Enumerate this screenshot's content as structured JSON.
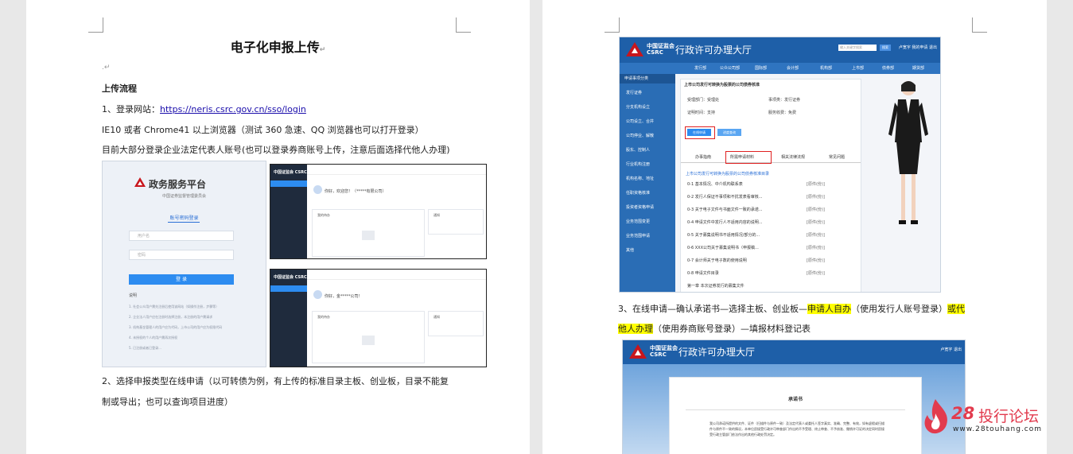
{
  "left_page": {
    "title": "电子化申报上传",
    "para_mark": "↵",
    "empty_mark": ".↵",
    "section_heading": "上传流程",
    "step1_prefix": "1、登录网站：",
    "step1_url": "https://neris.csrc.gov.cn/sso/login",
    "browser_note": "IE10 或者 Chrome41 以上浏览器（测试 360 急速、QQ 浏览器也可以打开登录）",
    "account_note": "目前大部分登录企业法定代表人账号(也可以登录券商账号上传，注意后面选择代他人办理)",
    "step2_line1": "2、选择申报类型在线申请（以可转债为例，有上传的标准目录主板、创业板，目录不能复",
    "step2_line2": "制或导出；也可以查询项目进度）",
    "login_shot": {
      "platform_name": "政务服务平台",
      "subtitle": "中国证券监督管理委员会",
      "tab_label": "账号密码登录",
      "username_placeholder": "用户名",
      "password_placeholder": "密码",
      "login_button": "登 录",
      "notes_title": "说明",
      "notes": [
        "1. 社会公众用户需先注册后使用该网站（如操作注册，步骤等）",
        "2. 企业法人用户应在注册时选择注册，本注册的用户需请求",
        "3. 机构基金管理人的用户应为代码，上市公司的用户应为权限代码",
        "4. 未授权的个人的用户需再次授权",
        "5. 已注册或者已登录..."
      ]
    },
    "dash_shot_1": {
      "brand": "中国证监会 CSRC",
      "welcome": "你好，欢迎您！（*****有限公司）",
      "card1_title": "我的待办",
      "card2_title": "通知"
    },
    "dash_shot_2": {
      "brand": "中国证监会 CSRC",
      "welcome": "你好，金*****公司！",
      "card1_title": "我的待办",
      "card2_title": "通知"
    }
  },
  "right_page": {
    "portal": {
      "org": "中国证监会",
      "org_en": "CSRC",
      "name": "行政许可办理大厅",
      "search_placeholder": "输入关键字搜索",
      "search_button": "搜索",
      "user_links": "卢宽宇  我的申请  退出",
      "nav": [
        "发行部",
        "公众公司部",
        "国际部",
        "会计部",
        "机构部",
        "上市部",
        "债券部",
        "期货部"
      ],
      "side_head": "申请事项分类",
      "side_items": [
        "发行证券",
        "分支机构设立",
        "公司设立、合并",
        "公司停业、解散",
        "股东、控制人",
        "行业机构注册",
        "机构名称、地址",
        "任职资格核准",
        "投资者资格申请",
        "业务范围变更",
        "业务范围申请",
        "其他"
      ],
      "main_title": "上市公司发行可转换为股票的公司债券核准",
      "dept_label": "受理部门：受理处",
      "matter_label": "事项类：发行证券",
      "cert_label": "证明时间：",
      "cert_value": "支持",
      "fee_label": "服务收费：",
      "fee_value": "免费",
      "btn_apply": "在线申请",
      "btn_query": "进度查询",
      "tabs": [
        "办事指南",
        "所需申请材料",
        "相关法律法规",
        "常见问题"
      ],
      "list_title": "上市公司发行可转换为股票的公司债券核准目录",
      "rows": [
        {
          "text": "0-1 基本情况、中介机构联系表",
          "status": "[原件(份)]"
        },
        {
          "text": "0-2 发行人保证不事项和不扰发表看审核...",
          "status": "[原件(份)]"
        },
        {
          "text": "0-3 关于电子文件与书面文件一致的承诺...",
          "status": "[原件(份)]"
        },
        {
          "text": "0-4 申请文件中发行人不适用内容的说明...",
          "status": "[原件(份)]"
        },
        {
          "text": "0-5 关于募集说明书不适用情况/部分的...",
          "status": "[原件(份)]"
        },
        {
          "text": "0-6 XXX公司关于募集说明书（申报稿...",
          "status": "[原件(份)]"
        },
        {
          "text": "0-7 会计师关于电子数的使用说明",
          "status": "[原件(份)]"
        },
        {
          "text": "0-8 申请文件目录",
          "status": "[原件(份)]"
        },
        {
          "text": "第一章 本次证券发行的募集文件",
          "status": ""
        }
      ]
    },
    "step3_prefix": "3、在线申请—确认承诺书—选择主板、创业板—",
    "step3_hl1": "申请人自办",
    "step3_mid": "（使用发行人账号登录）",
    "step3_hl2": "或代",
    "step3_hl3": "他人办理",
    "step3_suffix": "（使用券商账号登录）—填报材料登记表",
    "portal2": {
      "org": "中国证监会",
      "org_en": "CSRC",
      "name": "行政许可办理大厅",
      "user_links": "卢宽宇  退出",
      "card_title": "承诺书",
      "card_text": "我公司承诺所提供的文件、证件（扫描件与原件一致）及法定代表人或委托人签字真实、准确、完整、有效，如有虚假或扫描件与原件不一致的情况，本单位愿接受行政许可审查部门作出的不予受理、终止审查、不予核准、撤销许可证的决定同时愿接受行政主管部门依法作出的其他行政处罚决定。"
    }
  },
  "watermark": {
    "number": "28",
    "text": "投行论坛",
    "url": "www.28touhang.com"
  },
  "colors": {
    "highlight": "#ffff00",
    "portal_blue": "#1e5fa8",
    "watermark_red": "#e23b4e"
  }
}
